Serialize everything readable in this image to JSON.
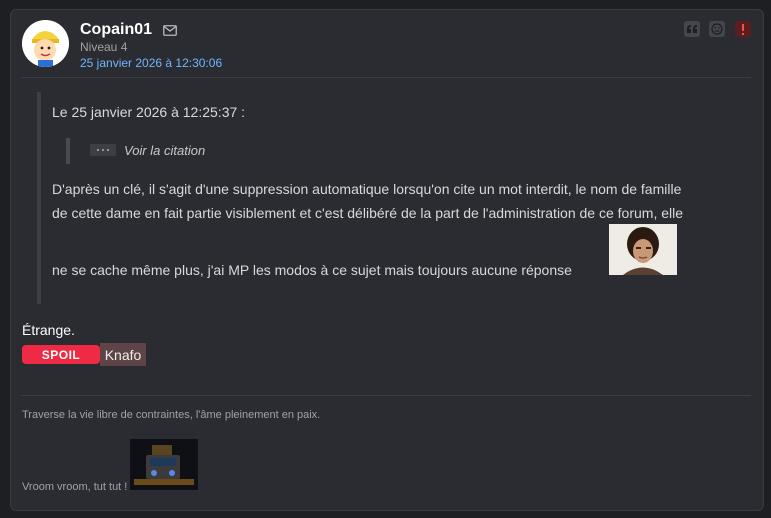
{
  "post": {
    "author": "Copain01",
    "level": "Niveau 4",
    "date": "25 janvier 2026 à 12:30:06",
    "actions": [
      {
        "name": "quote-button",
        "icon": "quote-icon"
      },
      {
        "name": "sad-face-button",
        "icon": "sad-face-icon"
      },
      {
        "name": "report-button",
        "icon": "exclamation-icon"
      }
    ],
    "mail_icon": "mail-icon"
  },
  "quote": {
    "header": "Le 25 janvier 2026 à 12:25:37 :",
    "nested_label": "Voir la citation",
    "line1": "D'après un clé, il s'agit d'une suppression automatique lorsqu'on cite un mot interdit, le nom de famille",
    "line2": "de cette dame en fait partie visiblement et c'est délibéré de la part de l'administration de ce forum, elle",
    "line3": "ne se cache même plus, j'ai MP les modos à ce sujet mais toujours aucune réponse"
  },
  "body": {
    "text": "Étrange.",
    "spoil_label": "SPOIL",
    "spoil_text": "Knafo"
  },
  "signature": {
    "line1": "Traverse la vie libre de contraintes, l'âme pleinement en paix.",
    "line2": "Vroom vroom, tut tut !"
  },
  "colors": {
    "background": "#1e1f23",
    "card": "#2b2c31",
    "date_link": "#6fb6ff",
    "spoil": "#ee2a44",
    "report": "#ff4b4b"
  }
}
